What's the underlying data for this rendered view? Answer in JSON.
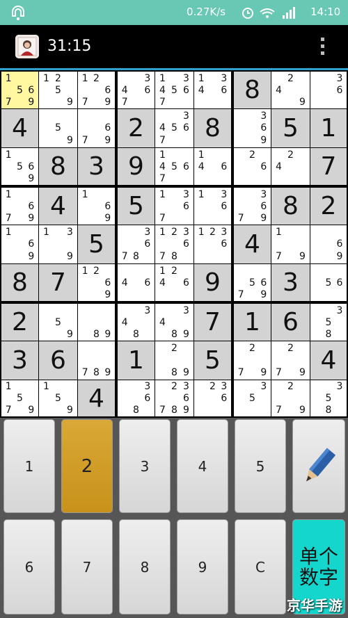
{
  "status_bar": {
    "network_speed": "0.27K/s",
    "time": "14:10",
    "icons": [
      "notification-icon",
      "alarm-icon",
      "wifi-icon",
      "signal-icon",
      "battery-icon"
    ]
  },
  "header": {
    "timer": "31:15"
  },
  "board": {
    "selected": [
      0,
      0
    ],
    "cells": [
      [
        {
          "n": "1 5 6 7 9"
        },
        {
          "n": "1 2 5 9"
        },
        {
          "n": "1 2 6 7 9"
        },
        {
          "n": "3 4 6 7"
        },
        {
          "n": "1 3 4 5 6 7"
        },
        {
          "n": "1 3 4 6"
        },
        {
          "v": "8"
        },
        {
          "n": "2 4 9"
        },
        {
          "n": "3 6"
        }
      ],
      [
        {
          "v": "4"
        },
        {
          "n": "5 9"
        },
        {
          "n": "6 7 9"
        },
        {
          "v": "2"
        },
        {
          "n": "3 4 5 6 7"
        },
        {
          "v": "8"
        },
        {
          "n": "3 6 9"
        },
        {
          "v": "5"
        },
        {
          "v": "1"
        }
      ],
      [
        {
          "n": "1 5 6 9"
        },
        {
          "v": "8"
        },
        {
          "v": "3"
        },
        {
          "v": "9"
        },
        {
          "n": "1 4 5 6 7"
        },
        {
          "n": "1 4 6"
        },
        {
          "n": "2 6"
        },
        {
          "n": "2 4"
        },
        {
          "v": "7"
        }
      ],
      [
        {
          "n": "1 6 7 9"
        },
        {
          "v": "4"
        },
        {
          "n": "1 6 9"
        },
        {
          "v": "5"
        },
        {
          "n": "1 3 6 7"
        },
        {
          "n": "1 3 6"
        },
        {
          "n": "3 6 7 9"
        },
        {
          "v": "8"
        },
        {
          "v": "2"
        }
      ],
      [
        {
          "n": "1 6 9"
        },
        {
          "n": "1 3 9"
        },
        {
          "v": "5"
        },
        {
          "n": "3 6 7 8"
        },
        {
          "n": "1 2 3 6 7 8"
        },
        {
          "n": "1 2 3 6"
        },
        {
          "v": "4"
        },
        {
          "n": "1 7 9"
        },
        {
          "n": "6 9"
        }
      ],
      [
        {
          "v": "8"
        },
        {
          "v": "7"
        },
        {
          "n": "1 2 6 9"
        },
        {
          "n": "4 6"
        },
        {
          "n": "1 2 4 6"
        },
        {
          "v": "9"
        },
        {
          "n": "5 6 7 9"
        },
        {
          "v": "3"
        },
        {
          "n": "5 6"
        }
      ],
      [
        {
          "v": "2"
        },
        {
          "n": "5 9"
        },
        {
          "n": "8 9"
        },
        {
          "n": "3 4 8"
        },
        {
          "n": "3 4 8 9"
        },
        {
          "v": "7"
        },
        {
          "v": "1"
        },
        {
          "v": "6"
        },
        {
          "n": "3 5 8"
        }
      ],
      [
        {
          "v": "3"
        },
        {
          "v": "6"
        },
        {
          "n": "7 8 9"
        },
        {
          "v": "1"
        },
        {
          "n": "2 8 9"
        },
        {
          "v": "5"
        },
        {
          "n": "2 7 9"
        },
        {
          "n": "2 7 9"
        },
        {
          "v": "4"
        }
      ],
      [
        {
          "n": "1 5 7 9"
        },
        {
          "n": "1 5 9"
        },
        {
          "v": "4"
        },
        {
          "n": "3 6 8"
        },
        {
          "n": "2 3 6 7 8 9"
        },
        {
          "n": "2 3 6"
        },
        {
          "n": "3 5"
        },
        {
          "n": "2 7 9"
        },
        {
          "n": "3 5 8"
        }
      ]
    ]
  },
  "keypad": {
    "keys": [
      "1",
      "2",
      "3",
      "4",
      "5",
      "6",
      "7",
      "8",
      "9",
      "C"
    ],
    "active_key": "2",
    "pencil_icon": "pencil-icon",
    "mode_label_line1": "单个",
    "mode_label_line2": "数字"
  },
  "watermark": "京华手游",
  "colors": {
    "status_bar": "#68c8b4",
    "accent_line": "#2ea1cf",
    "given_cell": "#d3d3d3",
    "selected_cell": "#fff8a0",
    "active_key": "#c8921a",
    "mode_key": "#14d6cc"
  }
}
